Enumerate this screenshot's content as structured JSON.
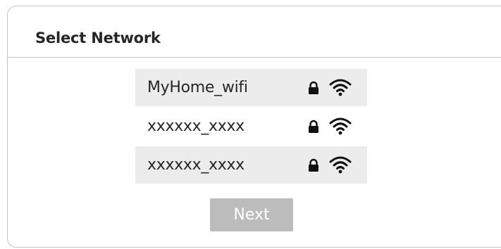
{
  "dialog": {
    "title": "Select Network"
  },
  "networks": [
    {
      "name": "MyHome_wifi",
      "secured_icon": "lock-icon",
      "signal_icon": "wifi-icon",
      "highlighted": true
    },
    {
      "name": "xxxxxx_xxxx",
      "secured_icon": "lock-icon",
      "signal_icon": "wifi-icon",
      "highlighted": false
    },
    {
      "name": "xxxxxx_xxxx",
      "secured_icon": "lock-icon",
      "signal_icon": "wifi-icon",
      "highlighted": true
    }
  ],
  "actions": {
    "next_label": "Next"
  },
  "colors": {
    "row_shade": "#ececec",
    "button_disabled": "#bcbcbc",
    "border": "#c4c4c4",
    "text": "#262626"
  }
}
